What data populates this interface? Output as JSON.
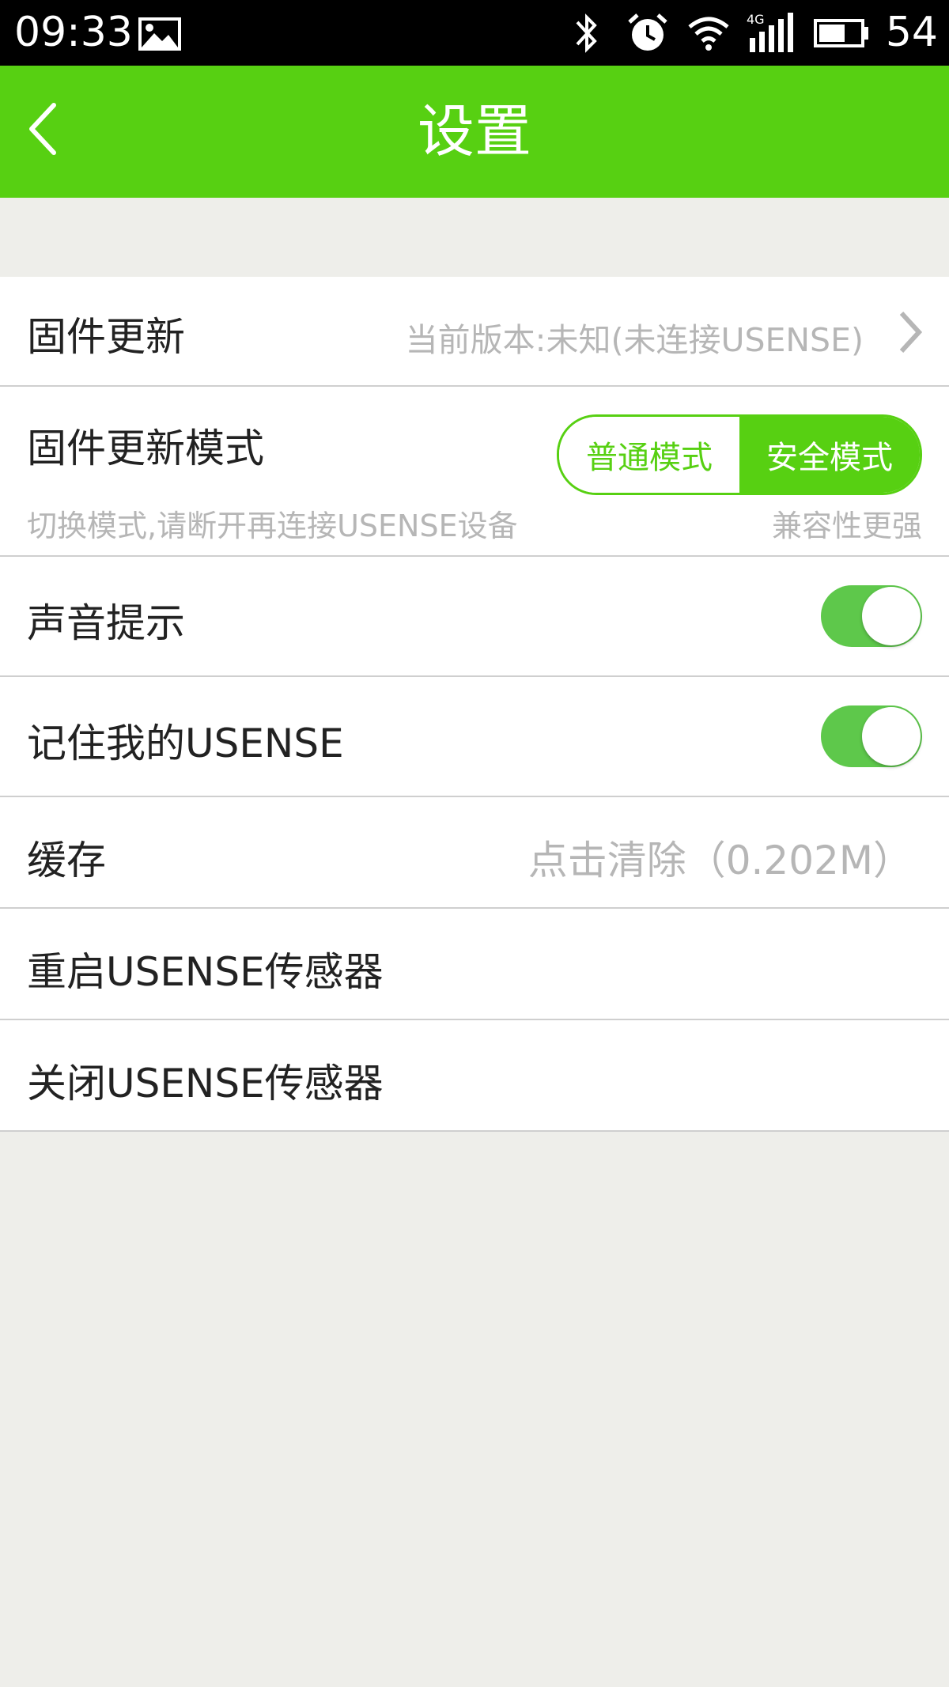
{
  "status_bar": {
    "time": "09:33",
    "battery_level": "54",
    "icons": [
      "image-icon",
      "bluetooth-icon",
      "alarm-icon",
      "wifi-icon",
      "4g-signal-icon",
      "battery-icon"
    ]
  },
  "header": {
    "title": "设置",
    "back_icon": "chevron-left-icon",
    "background_color": "#57d012"
  },
  "settings": {
    "firmware_update": {
      "label": "固件更新",
      "value": "当前版本:未知(未连接USENSE)",
      "icon": "chevron-right-icon"
    },
    "firmware_mode": {
      "label": "固件更新模式",
      "options": [
        "普通模式",
        "安全模式"
      ],
      "selected": "安全模式",
      "hint_left": "切换模式,请断开再连接USENSE设备",
      "hint_right": "兼容性更强"
    },
    "sound_prompt": {
      "label": "声音提示",
      "enabled": true
    },
    "remember_usense": {
      "label": "记住我的USENSE",
      "enabled": true
    },
    "cache": {
      "label": "缓存",
      "value": "点击清除（0.202M）"
    },
    "restart_sensor": {
      "label": "重启USENSE传感器"
    },
    "close_sensor": {
      "label": "关闭USENSE传感器"
    }
  },
  "colors": {
    "accent": "#57d012",
    "toggle_on": "#5ec84b",
    "secondary_text": "#b6b6b6",
    "page_background": "#eeeeea"
  }
}
